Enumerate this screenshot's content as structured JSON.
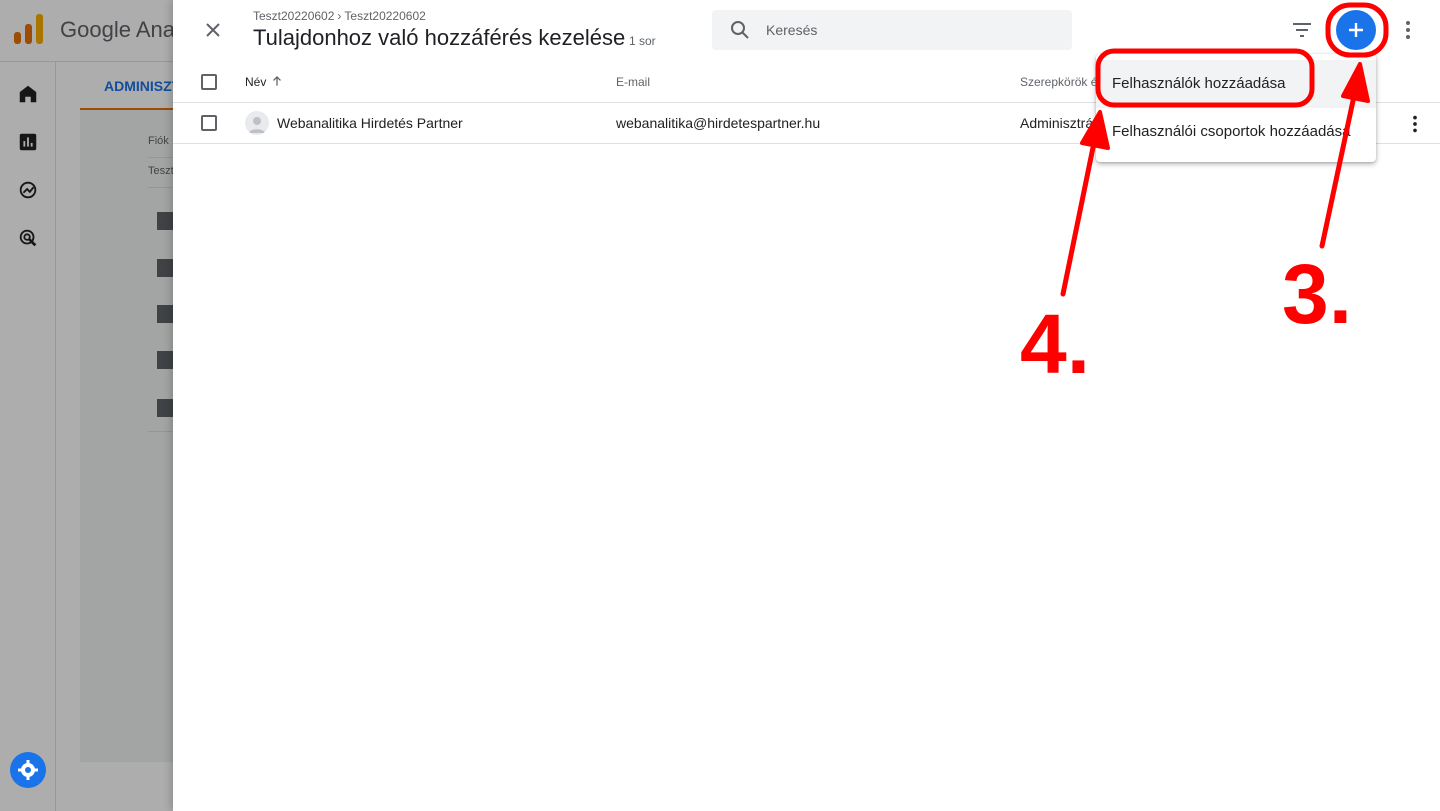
{
  "background_app": {
    "app_title": "Google Ana",
    "tab_label": "ADMINISZT",
    "account_label": "Fiók",
    "account_value": "Teszt"
  },
  "panel": {
    "breadcrumb": [
      "Teszt20220602",
      "Teszt20220602"
    ],
    "breadcrumb_separator": "›",
    "title": "Tulajdonhoz való hozzáférés kezelése",
    "row_count": "1 sor",
    "search": {
      "placeholder": "Keresés",
      "value": ""
    }
  },
  "table": {
    "columns": [
      "Név",
      "E-mail",
      "Szerepkörök é"
    ],
    "rows": [
      {
        "name": "Webanalitika Hirdetés Partner",
        "email": "webanalitika@hirdetespartner.hu",
        "role": "Adminisztrá"
      }
    ]
  },
  "add_menu": {
    "items": [
      {
        "label": "Felhasználók hozzáadása"
      },
      {
        "label": "Felhasználói csoportok hozzáadása"
      }
    ]
  },
  "annotations": {
    "step3": "3.",
    "step4": "4."
  },
  "colors": {
    "accent": "#1a73e8",
    "annotation": "#ff0000",
    "ga_orange": "#e8710a",
    "ga_yellow": "#f9ab00"
  },
  "icons": [
    "close-icon",
    "search-icon",
    "filter-icon",
    "add-icon",
    "more-vert-icon",
    "sort-arrow-up-icon",
    "avatar-icon",
    "settings-icon"
  ]
}
